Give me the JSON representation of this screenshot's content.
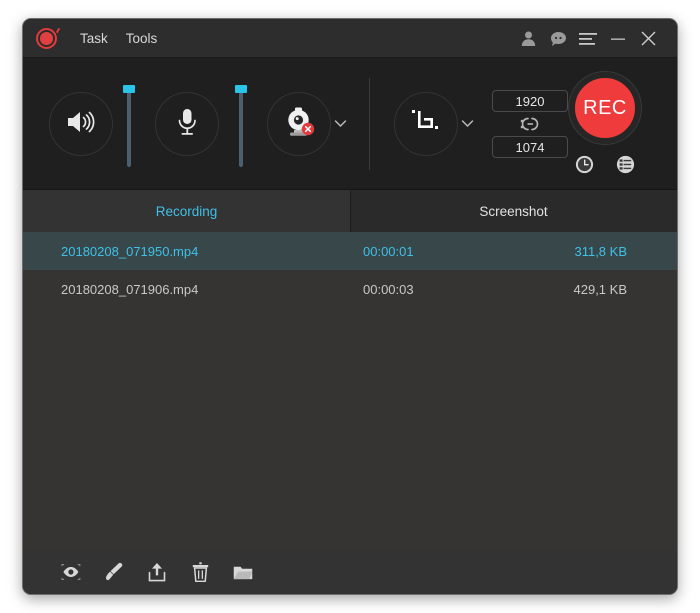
{
  "window": {
    "titlebar": {
      "logo_icon": "record-logo-icon",
      "menus": [
        {
          "label": "Task",
          "name": "menu-task"
        },
        {
          "label": "Tools",
          "name": "menu-tools"
        }
      ],
      "right_icons": [
        {
          "name": "account-icon",
          "label": "account"
        },
        {
          "name": "feedback-chat-icon",
          "label": "feedback"
        },
        {
          "name": "hamburger-menu-icon",
          "label": "menu"
        },
        {
          "name": "minimize-icon",
          "label": "minimize"
        },
        {
          "name": "close-icon",
          "label": "close"
        }
      ]
    },
    "controls": {
      "speaker": {
        "icon": "speaker-icon",
        "slider_value": 100
      },
      "microphone": {
        "icon": "microphone-icon",
        "slider_value": 100
      },
      "webcam": {
        "icon": "webcam-icon",
        "badge": "disabled-x-badge",
        "chevron": "chevron-down-icon"
      },
      "crop": {
        "icon": "crop-region-icon",
        "chevron": "chevron-down-icon"
      },
      "size": {
        "width": "1920",
        "height": "1074",
        "lock_icon": "aspect-ratio-link-icon"
      },
      "record": {
        "label": "REC",
        "color": "#ef3b3b"
      },
      "sub_icons": [
        {
          "name": "scheduler-clock-icon",
          "label": "scheduler"
        },
        {
          "name": "settings-list-icon",
          "label": "settings"
        }
      ]
    },
    "tabs": [
      {
        "label": "Recording",
        "name": "tab-recording",
        "active": true
      },
      {
        "label": "Screenshot",
        "name": "tab-screenshot",
        "active": false
      }
    ],
    "files": [
      {
        "name": "20180208_071950.mp4",
        "duration": "00:00:01",
        "size": "311,8 KB",
        "selected": true
      },
      {
        "name": "20180208_071906.mp4",
        "duration": "00:00:03",
        "size": "429,1 KB",
        "selected": false
      }
    ],
    "bottom_toolbar": [
      {
        "name": "preview-eye-icon",
        "label": "Preview"
      },
      {
        "name": "edit-brush-icon",
        "label": "Edit"
      },
      {
        "name": "upload-share-icon",
        "label": "Upload"
      },
      {
        "name": "delete-trash-icon",
        "label": "Delete"
      },
      {
        "name": "open-folder-icon",
        "label": "Open folder"
      }
    ],
    "colors": {
      "accent": "#3fc0e8",
      "record_red": "#ef3b3b",
      "selected_row_bg": "#37474a",
      "list_bg": "#363432",
      "panel_bg": "#1f1f1f",
      "titlebar_bg": "#2d2d2d"
    }
  }
}
